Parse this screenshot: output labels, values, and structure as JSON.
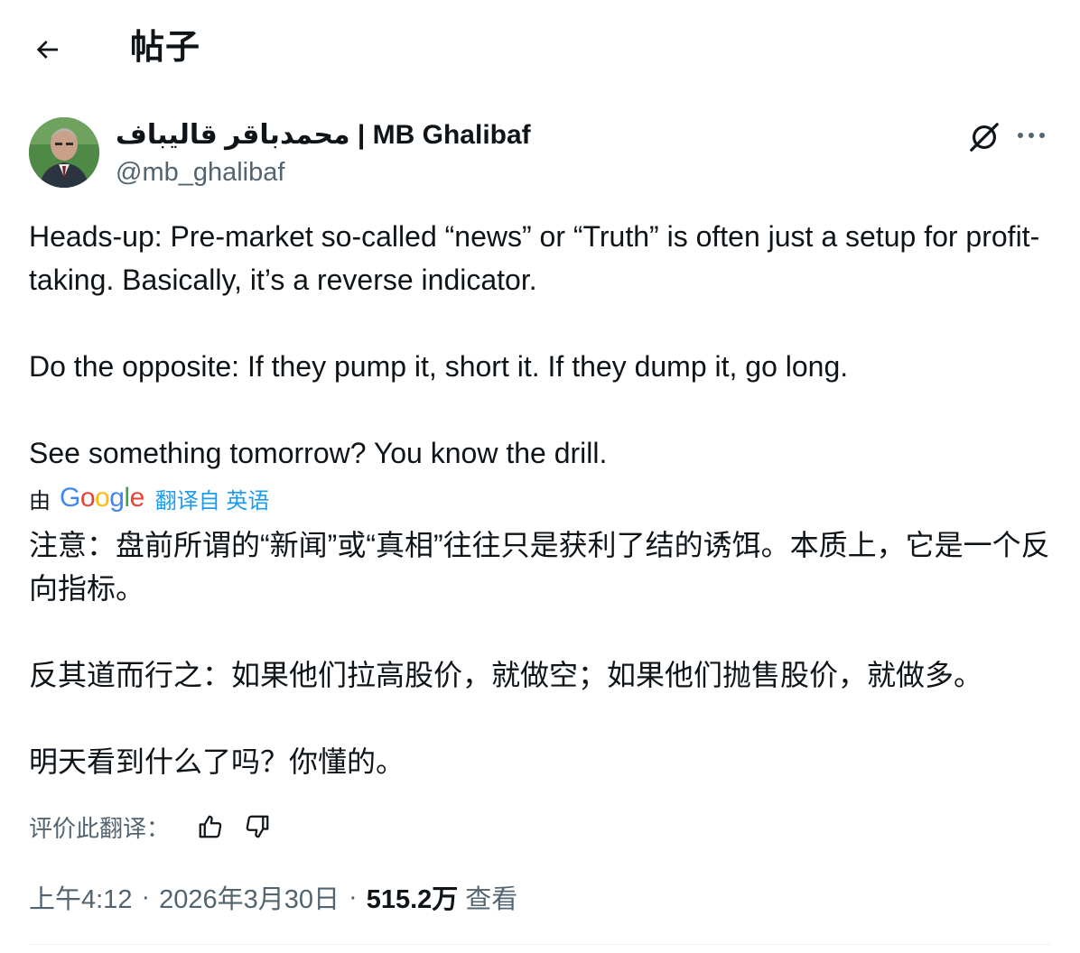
{
  "header": {
    "title": "帖子"
  },
  "tweet": {
    "author": {
      "name": "محمدباقر قالیباف | MB Ghalibaf",
      "handle": "@mb_ghalibaf"
    },
    "original": {
      "paragraphs": [
        "Heads-up: Pre-market so-called “news” or “Truth” is often just a setup for profit-taking. Basically, it’s a reverse indicator.",
        "Do the opposite: If they pump it, short it. If they dump it, go long.",
        "See something tomorrow? You know the drill."
      ]
    },
    "translation": {
      "by_label": "由",
      "provider": "Google",
      "from_label": "翻译自 英语",
      "paragraphs": [
        "注意：盘前所谓的“新闻”或“真相”往往只是获利了结的诱饵。本质上，它是一个反向指标。",
        "反其道而行之：如果他们拉高股价，就做空；如果他们抛售股价，就做多。",
        "明天看到什么了吗？你懂的。"
      ],
      "rate_label": "评价此翻译："
    },
    "meta": {
      "time": "上午4:12",
      "date": "2026年3月30日",
      "separator": "·",
      "views": "515.2万",
      "views_label": "查看"
    }
  },
  "icons": {
    "back": "arrow-left-icon",
    "grok": "grok-icon",
    "more": "more-horizontal-icon",
    "thumbs_up": "thumbs-up-icon",
    "thumbs_down": "thumbs-down-icon"
  },
  "colors": {
    "text": "#0f1419",
    "secondary": "#536471",
    "link": "#1d9bf0",
    "divider": "#eff3f4"
  }
}
